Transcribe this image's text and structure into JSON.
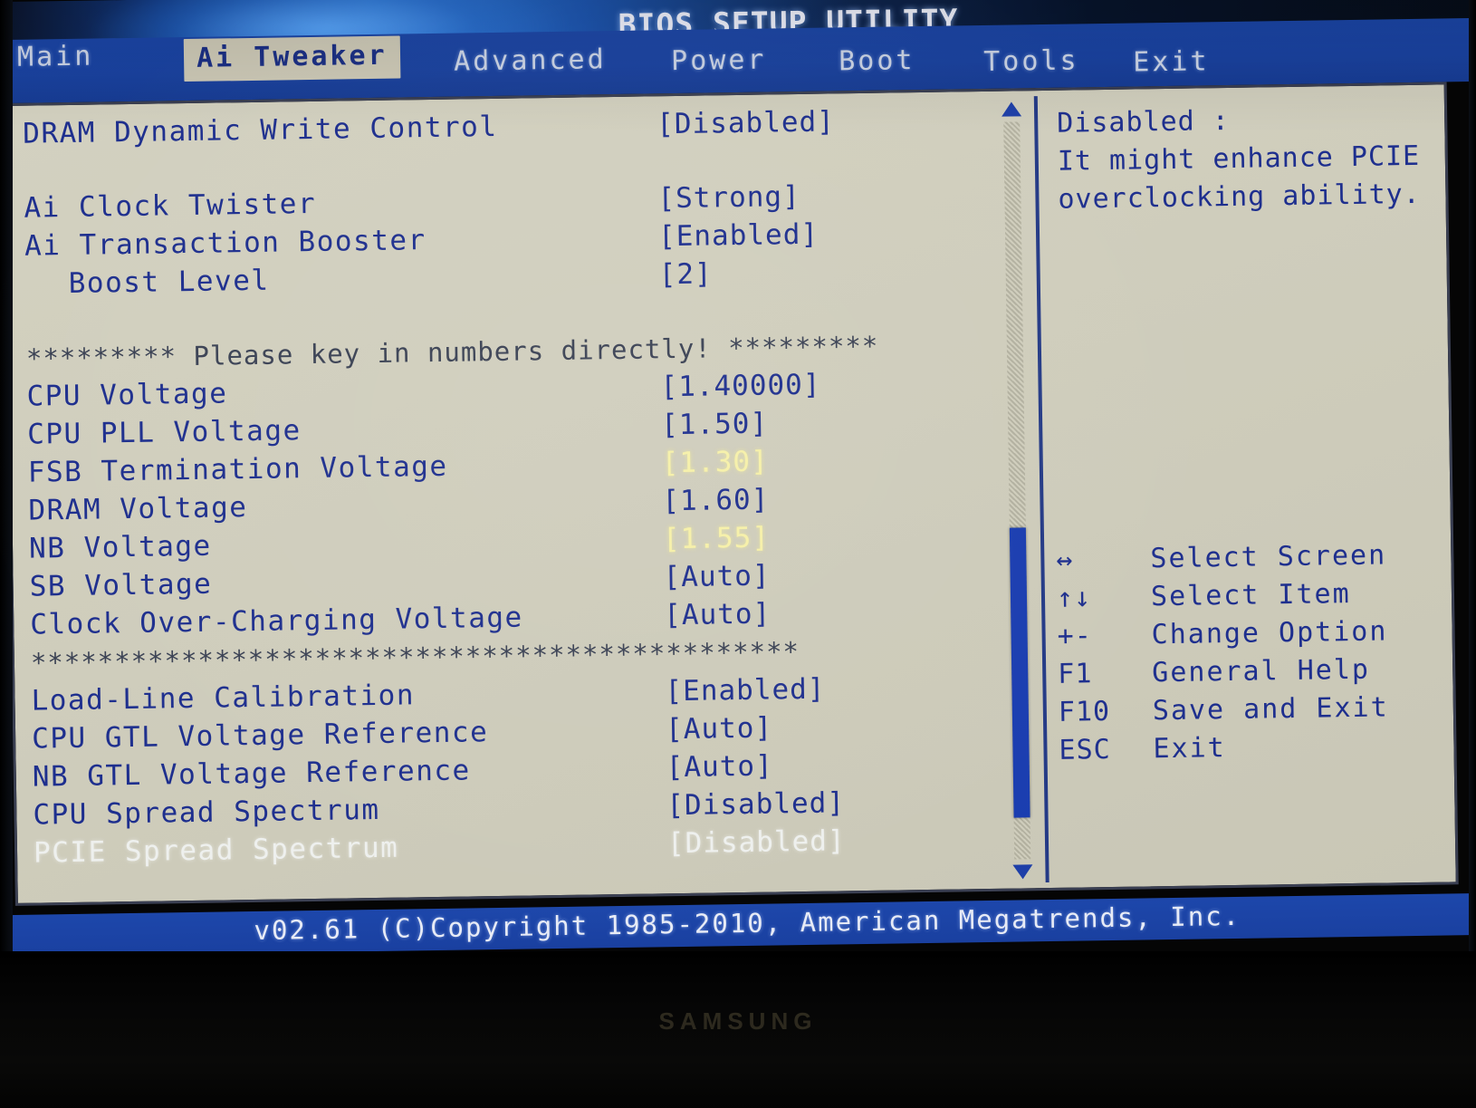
{
  "monitor": {
    "brand": "SAMSUNG"
  },
  "header": {
    "title": "BIOS SETUP UTILITY",
    "tabs": [
      {
        "label": "Main",
        "active": false
      },
      {
        "label": "Ai Tweaker",
        "active": true
      },
      {
        "label": "Advanced",
        "active": false
      },
      {
        "label": "Power",
        "active": false
      },
      {
        "label": "Boot",
        "active": false
      },
      {
        "label": "Tools",
        "active": false
      },
      {
        "label": "Exit",
        "active": false
      }
    ]
  },
  "settings": [
    {
      "label": "DRAM Dynamic Write Control",
      "value": "[Disabled]",
      "highlight": false,
      "selected": false,
      "indent": false
    },
    {
      "label": "Ai Clock Twister",
      "value": "[Strong]",
      "highlight": false,
      "selected": false,
      "indent": false
    },
    {
      "label": "Ai Transaction Booster",
      "value": "[Enabled]",
      "highlight": false,
      "selected": false,
      "indent": false
    },
    {
      "label": "Boost Level",
      "value": "[2]",
      "highlight": false,
      "selected": false,
      "indent": true
    },
    {
      "label": "CPU Voltage",
      "value": "[1.40000]",
      "highlight": false,
      "selected": false,
      "indent": false
    },
    {
      "label": "CPU PLL Voltage",
      "value": "[1.50]",
      "highlight": false,
      "selected": false,
      "indent": false
    },
    {
      "label": "FSB Termination Voltage",
      "value": "[1.30]",
      "highlight": true,
      "selected": false,
      "indent": false
    },
    {
      "label": "DRAM Voltage",
      "value": "[1.60]",
      "highlight": false,
      "selected": false,
      "indent": false
    },
    {
      "label": "NB Voltage",
      "value": "[1.55]",
      "highlight": true,
      "selected": false,
      "indent": false
    },
    {
      "label": "SB Voltage",
      "value": "[Auto]",
      "highlight": false,
      "selected": false,
      "indent": false
    },
    {
      "label": "Clock Over-Charging Voltage",
      "value": "[Auto]",
      "highlight": false,
      "selected": false,
      "indent": false
    },
    {
      "label": "Load-Line Calibration",
      "value": "[Enabled]",
      "highlight": false,
      "selected": false,
      "indent": false
    },
    {
      "label": "CPU GTL Voltage Reference",
      "value": "[Auto]",
      "highlight": false,
      "selected": false,
      "indent": false
    },
    {
      "label": "NB GTL Voltage Reference",
      "value": "[Auto]",
      "highlight": false,
      "selected": false,
      "indent": false
    },
    {
      "label": "CPU Spread Spectrum",
      "value": "[Disabled]",
      "highlight": false,
      "selected": false,
      "indent": false
    },
    {
      "label": "PCIE Spread Spectrum",
      "value": "[Disabled]",
      "highlight": false,
      "selected": true,
      "indent": false
    }
  ],
  "separators": {
    "key_in_numbers": "********* Please key in numbers directly! *********",
    "stars": "**********************************************"
  },
  "help": {
    "lines": [
      "Disabled :",
      "It might enhance PCIE",
      "overclocking ability."
    ]
  },
  "legend": [
    {
      "key": "↔",
      "text": "Select Screen"
    },
    {
      "key": "↑↓",
      "text": "Select Item"
    },
    {
      "key": "+-",
      "text": "Change Option"
    },
    {
      "key": "F1",
      "text": "General Help"
    },
    {
      "key": "F10",
      "text": "Save and Exit"
    },
    {
      "key": "ESC",
      "text": "Exit"
    }
  ],
  "footer": {
    "copyright": "v02.61  (C)Copyright 1985-2010, American Megatrends, Inc."
  },
  "colors": {
    "panel_bg": "#d0cebd",
    "text_blue": "#1e2f8e",
    "highlight_yellow": "#f6f0a8",
    "bar_blue": "#1a40a0",
    "selected_white": "#eef0ee"
  }
}
